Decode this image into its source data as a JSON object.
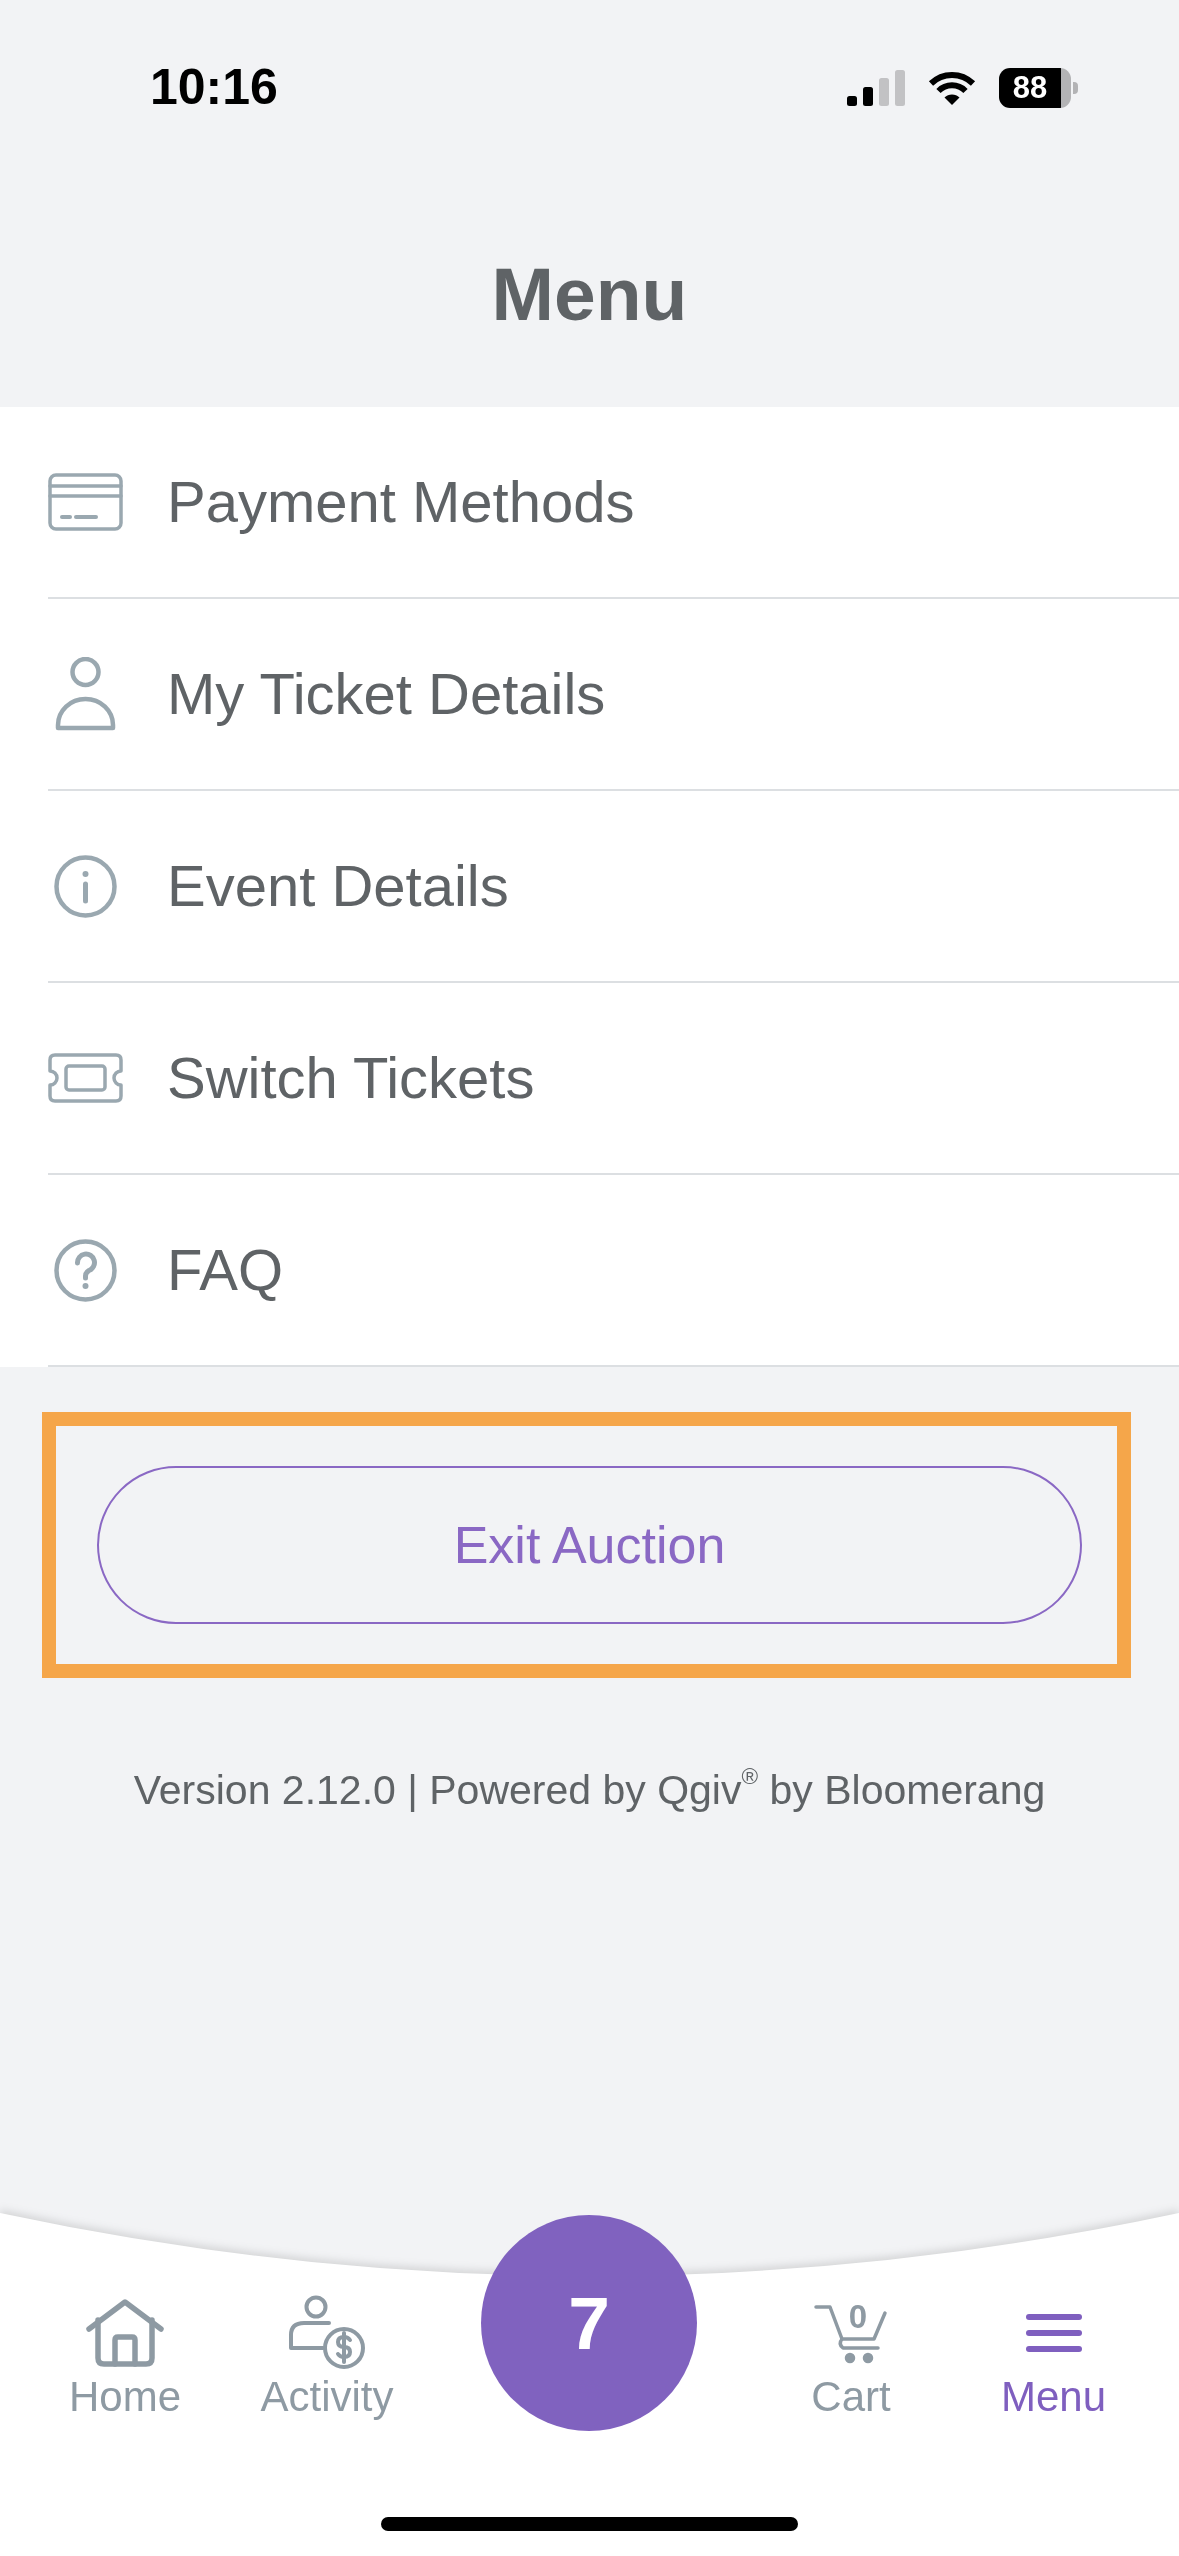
{
  "status_bar": {
    "time": "10:16",
    "battery": "88"
  },
  "header": {
    "title": "Menu"
  },
  "menu_items": [
    {
      "label": "Payment Methods"
    },
    {
      "label": "My Ticket Details"
    },
    {
      "label": "Event Details"
    },
    {
      "label": "Switch Tickets"
    },
    {
      "label": "FAQ"
    }
  ],
  "exit_button": {
    "label": "Exit Auction",
    "highlighted": true
  },
  "footer": {
    "version": "Version 2.12.0 | Powered by Qgiv$^{®}$ by Bloomerang"
  },
  "tab_bar": {
    "items": [
      {
        "label": "Home",
        "selected": false
      },
      {
        "label": "Activity",
        "selected": false
      },
      {
        "label": "Cart",
        "selected": false,
        "badge": "0"
      },
      {
        "label": "Menu",
        "selected": true
      }
    ],
    "center_button": {
      "label": "7"
    }
  }
}
